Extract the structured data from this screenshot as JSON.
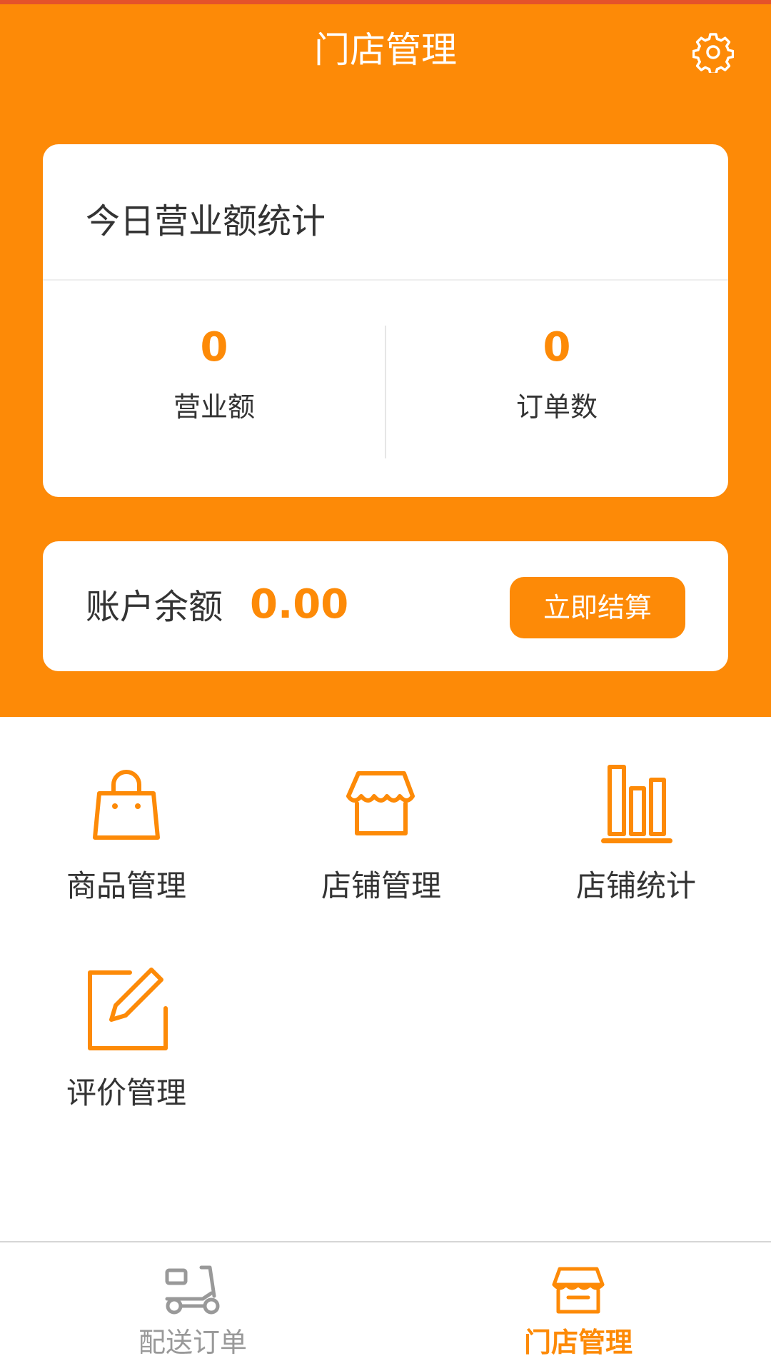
{
  "header": {
    "title": "门店管理",
    "settings_icon": "gear-icon"
  },
  "stats": {
    "title": "今日营业额统计",
    "revenue_value": "0",
    "revenue_label": "营业额",
    "orders_value": "0",
    "orders_label": "订单数"
  },
  "balance": {
    "label": "账户余额",
    "value": "0.00",
    "settle_button": "立即结算"
  },
  "menu": {
    "items": [
      {
        "label": "商品管理",
        "icon": "shopping-bag-icon"
      },
      {
        "label": "店铺管理",
        "icon": "storefront-icon"
      },
      {
        "label": "店铺统计",
        "icon": "bar-chart-icon"
      },
      {
        "label": "评价管理",
        "icon": "edit-icon"
      }
    ]
  },
  "bottom_nav": {
    "items": [
      {
        "label": "配送订单",
        "icon": "scooter-icon",
        "active": false
      },
      {
        "label": "门店管理",
        "icon": "storefront-icon",
        "active": true
      }
    ]
  },
  "colors": {
    "brand_orange": "#FD8A07",
    "top_accent": "#E5532A",
    "text_dark": "#333333",
    "nav_inactive": "#999999"
  }
}
